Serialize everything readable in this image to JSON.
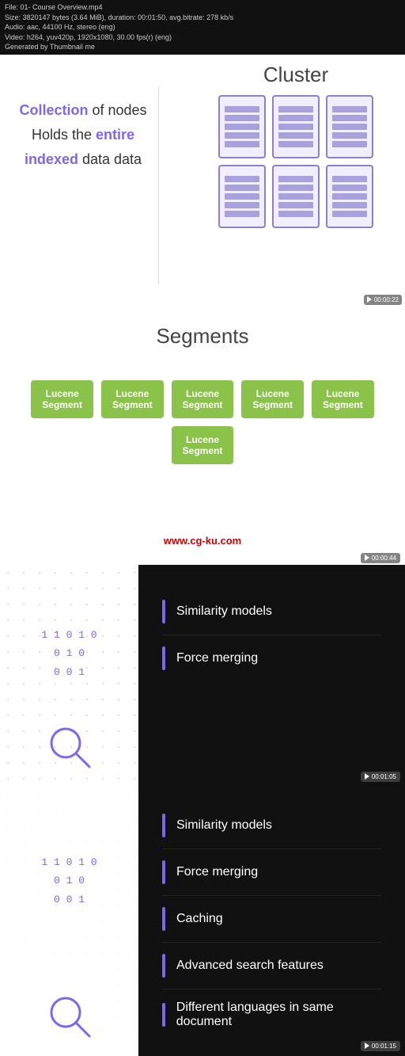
{
  "infobar": {
    "line1": "File: 01- Course Overview.mp4",
    "line2": "Size: 3820147 bytes (3.64 MiB), duration: 00:01:50, avg.bitrate: 278 kb/s",
    "line3": "Audio: aac, 44100 Hz, stereo (eng)",
    "line4": "Video: h264, yuv420p, 1920x1080, 30.00 fps(r) (eng)",
    "line5": "Generated by Thumbnail me"
  },
  "cluster": {
    "title": "Cluster",
    "left_text1_normal": " of nodes",
    "left_text1_highlight": "Collection",
    "left_text2_prefix": "Holds the ",
    "left_text2_highlight": "entire",
    "left_text2_suffix": "",
    "left_text3_highlight": "indexed",
    "left_text3_suffix": " data",
    "timestamp": "00:00:22",
    "server_count": 6,
    "rack_lines": 5
  },
  "segments": {
    "title": "Segments",
    "blocks": [
      {
        "label": "Lucene\nSegment"
      },
      {
        "label": "Lucene\nSegment"
      },
      {
        "label": "Lucene\nSegment"
      },
      {
        "label": "Lucene\nSegment"
      },
      {
        "label": "Lucene\nSegment"
      },
      {
        "label": "Lucene\nSegment"
      }
    ],
    "watermark": "www.cg-ku.com",
    "timestamp": "00:00:44"
  },
  "panel1": {
    "binary": "1 1 0 1 0\n0 1 0\n0 0 1 ↑",
    "items": [
      {
        "text": "Similarity models"
      },
      {
        "text": "Force merging"
      }
    ],
    "timestamp": "00:01:05"
  },
  "panel2": {
    "binary": "1 1 0 1 0\n0 1 0\n0 0 1 ↑",
    "items": [
      {
        "text": "Similarity models"
      },
      {
        "text": "Force merging"
      },
      {
        "text": "Caching"
      },
      {
        "text": "Advanced search features"
      },
      {
        "text": "Different languages in same document"
      }
    ],
    "timestamp": "00:01:15"
  }
}
